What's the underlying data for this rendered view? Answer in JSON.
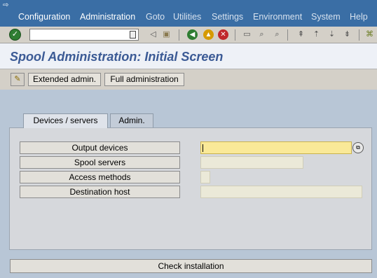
{
  "menu": {
    "items": [
      {
        "label": "Configuration",
        "state": "active"
      },
      {
        "label": "Administration",
        "state": "active"
      },
      {
        "label": "Goto",
        "state": "inactive"
      },
      {
        "label": "Utilities",
        "state": "inactive"
      },
      {
        "label": "Settings",
        "state": "inactive"
      },
      {
        "label": "Environment",
        "state": "inactive"
      },
      {
        "label": "System",
        "state": "inactive"
      },
      {
        "label": "Help",
        "state": "inactive"
      }
    ]
  },
  "toolbar": {
    "command_field_value": "",
    "icons": [
      "enter-icon",
      "back-icon",
      "exit-icon",
      "cancel-icon",
      "print-icon",
      "find-icon",
      "find-next-icon",
      "first-page-icon",
      "previous-page-icon",
      "next-page-icon",
      "last-page-icon",
      "create-session-icon"
    ]
  },
  "page": {
    "title": "Spool Administration: Initial Screen"
  },
  "app_toolbar": {
    "extended_admin_label": "Extended admin.",
    "full_admin_label": "Full administration"
  },
  "tabs": [
    {
      "label": "Devices / servers",
      "selected": true
    },
    {
      "label": "Admin.",
      "selected": false
    }
  ],
  "fields": [
    {
      "label": "Output devices",
      "value": ""
    },
    {
      "label": "Spool servers",
      "value": ""
    },
    {
      "label": "Access methods",
      "value": ""
    },
    {
      "label": "Destination host",
      "value": ""
    }
  ],
  "check_installation_label": "Check installation",
  "colors": {
    "menubar": "#3a6ea5",
    "title_text": "#3b5a95",
    "focused_field": "#fae998"
  }
}
